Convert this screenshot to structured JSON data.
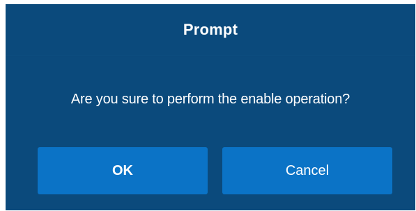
{
  "dialog": {
    "title": "Prompt",
    "message": "Are you sure to perform the enable operation?",
    "buttons": {
      "ok_label": "OK",
      "cancel_label": "Cancel"
    }
  },
  "colors": {
    "dialog_background": "#0b4a7c",
    "button_background": "#0b73c6",
    "text": "#ffffff"
  }
}
